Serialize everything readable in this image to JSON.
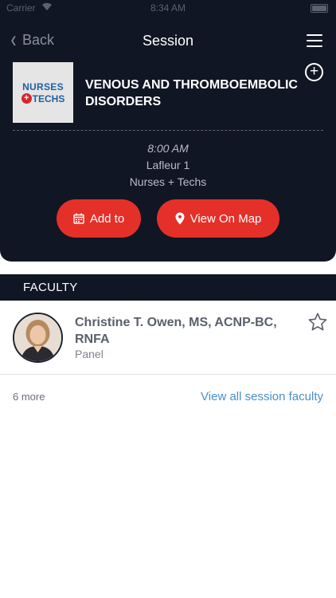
{
  "status_bar": {
    "carrier": "Carrier",
    "time": "8:34 AM"
  },
  "nav": {
    "back_label": "Back",
    "title": "Session"
  },
  "session": {
    "logo_line1": "NURSES",
    "logo_line2": "TECHS",
    "title": "VENOUS AND THROMBOEMBOLIC DISORDERS",
    "time": "8:00 AM",
    "room": "Lafleur 1",
    "track": "Nurses + Techs"
  },
  "actions": {
    "add_label": "Add to",
    "map_label": "View On Map"
  },
  "faculty": {
    "section_title": "FACULTY",
    "members": [
      {
        "name": "Christine T. Owen, MS, ACNP-BC, RNFA",
        "role": "Panel"
      }
    ],
    "more_count": "6 more",
    "view_all_label": "View all session faculty"
  },
  "colors": {
    "header_bg": "#111624",
    "accent_red": "#e5302a",
    "link_blue": "#4a90c8"
  },
  "icons": [
    "wifi-icon",
    "battery-icon",
    "back-chevron-icon",
    "menu-icon",
    "add-circle-icon",
    "calendar-icon",
    "location-pin-icon",
    "star-icon"
  ]
}
